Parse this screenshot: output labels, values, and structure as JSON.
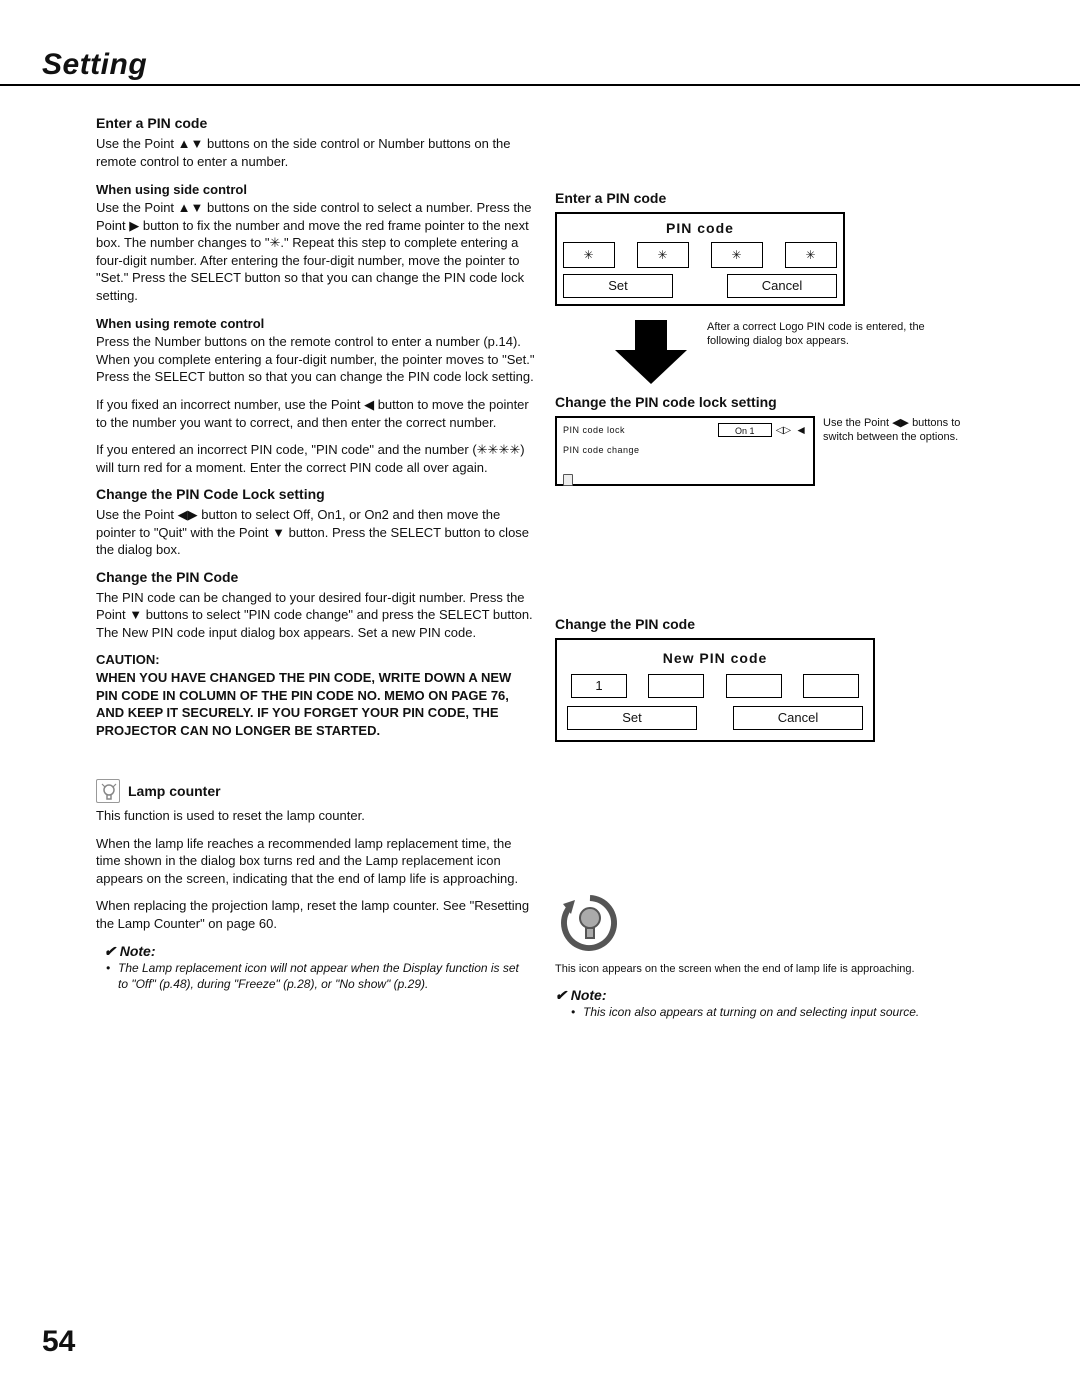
{
  "header": {
    "title": "Setting"
  },
  "page_number": "54",
  "left": {
    "enter_pin": {
      "heading": "Enter a PIN code",
      "intro": "Use the Point ▲▼ buttons on the side control or Number buttons on the remote control to enter a number."
    },
    "side_control": {
      "heading": "When using side control",
      "body": "Use the Point ▲▼ buttons on the side control to select a number. Press the Point ▶ button to fix the number and move the red frame pointer to the next box. The number changes to \"✳.\" Repeat this step to complete entering a four-digit number. After entering the four-digit number, move the pointer to \"Set.\" Press the SELECT button so that you can change the PIN code lock setting."
    },
    "remote_control": {
      "heading": "When using remote control",
      "body": "Press the Number buttons on the remote control to enter a number (p.14). When you complete entering a four-digit number, the pointer moves to \"Set.\" Press the SELECT button so that you can change the PIN code lock setting."
    },
    "fix_number": "If you fixed an incorrect number, use the Point ◀ button to move the pointer to the number you want to correct, and then enter the correct number.",
    "wrong_pin": "If you entered an incorrect PIN code, \"PIN code\" and the number (✳✳✳✳) will turn red for a moment. Enter the correct PIN code all over again.",
    "change_lock": {
      "heading": "Change the PIN Code Lock setting",
      "body": "Use the Point ◀▶ button to select Off, On1, or On2 and then move the pointer to \"Quit\" with the Point ▼ button. Press the SELECT button to close the dialog box."
    },
    "change_pin": {
      "heading": "Change the PIN Code",
      "body": "The PIN code can be changed to your desired four-digit number. Press the Point ▼ buttons to select \"PIN code change\" and press the SELECT button. The New PIN code input dialog box appears. Set a new PIN code."
    },
    "caution": {
      "label": "CAUTION:",
      "body": "WHEN YOU HAVE CHANGED THE PIN CODE, WRITE DOWN A NEW PIN CODE IN COLUMN OF THE PIN CODE NO. MEMO ON PAGE 76, AND KEEP IT SECURELY. IF YOU FORGET YOUR PIN CODE, THE PROJECTOR CAN NO LONGER BE STARTED."
    },
    "lamp_counter": {
      "heading": "Lamp counter",
      "p1": "This function is used to reset the lamp counter.",
      "p2": "When the lamp life reaches a recommended lamp replacement time, the time shown in the dialog box turns red and the Lamp replacement icon appears on the screen, indicating that the end of lamp life is approaching.",
      "p3": "When replacing the projection lamp, reset the lamp counter. See \"Resetting the Lamp Counter\" on page 60.",
      "note_label": "Note:",
      "note_item": "The Lamp replacement icon will not appear when the Display function is set to \"Off\" (p.48), during \"Freeze\" (p.28), or \"No show\" (p.29)."
    }
  },
  "right": {
    "enter_pin_heading": "Enter a PIN code",
    "pin_dialog": {
      "title": "PIN code",
      "boxes": [
        "✳",
        "✳",
        "✳",
        "✳"
      ],
      "set": "Set",
      "cancel": "Cancel"
    },
    "arrow_text": "After a correct Logo PIN code is entered, the following dialog box appears.",
    "lock_heading": "Change the PIN code lock setting",
    "lock_dialog": {
      "row1_label": "PIN code lock",
      "row1_value": "On 1",
      "row2_label": "PIN code change"
    },
    "lock_side_text": "Use the Point ◀▶ buttons to switch between the options.",
    "change_pin_heading": "Change the PIN code",
    "new_pin_dialog": {
      "title": "New PIN code",
      "boxes": [
        "1",
        "",
        "",
        ""
      ],
      "set": "Set",
      "cancel": "Cancel"
    },
    "lamp_icon_caption": "This icon appears on the screen when the end of lamp life is approaching.",
    "note_label": "Note:",
    "note_item": "This icon also appears at turning on and selecting input source."
  }
}
